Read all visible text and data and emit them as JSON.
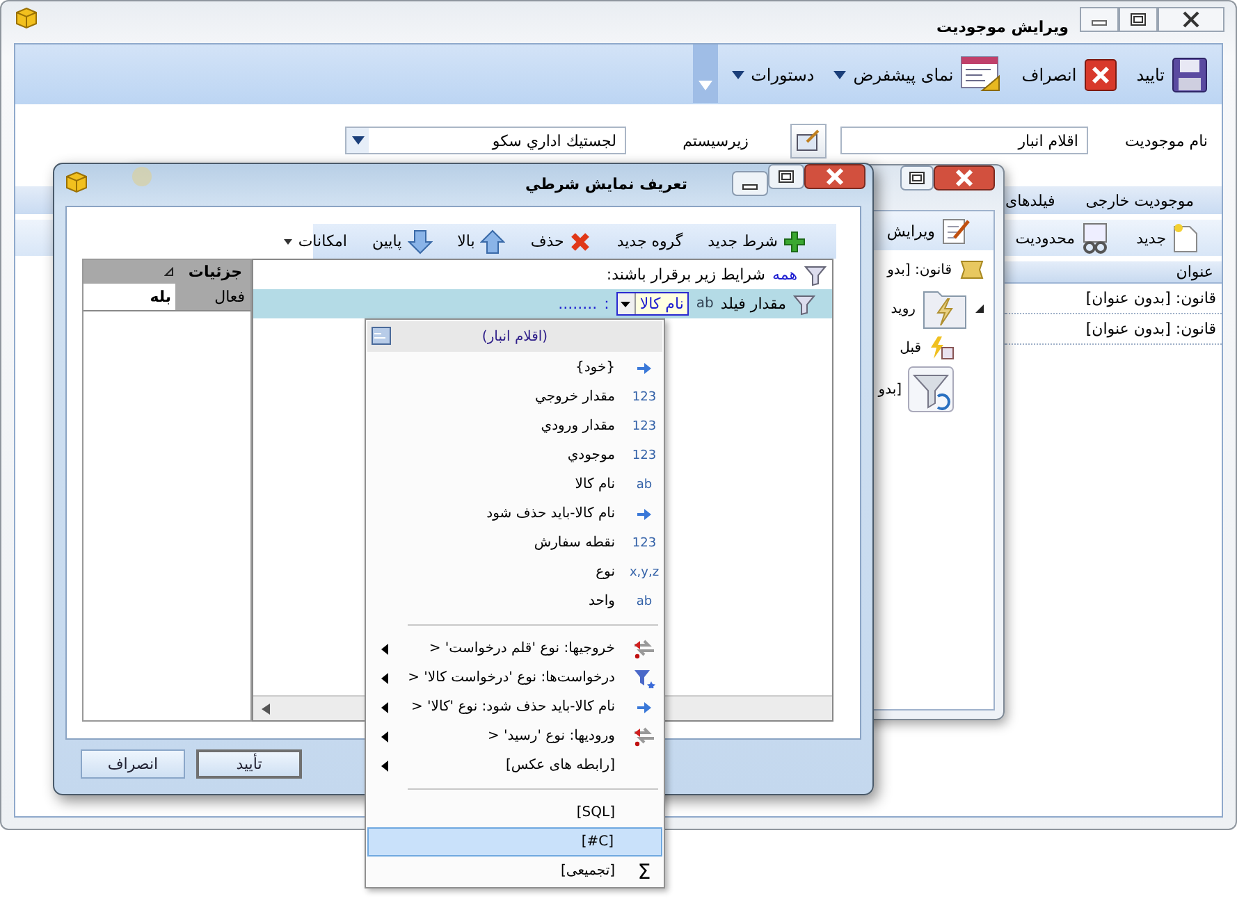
{
  "main_window": {
    "title": "ویرایش موجودیت"
  },
  "main_toolbar": [
    {
      "kind": "save",
      "label": "تایید",
      "dropdown": false
    },
    {
      "kind": "cancel",
      "label": "انصراف",
      "dropdown": false
    },
    {
      "kind": "layout",
      "label": "نمای پیشفرض",
      "dropdown": true
    },
    {
      "kind": "none",
      "label": "دستورات",
      "dropdown": true
    }
  ],
  "entity_name": {
    "label": "نام موجودیت",
    "value": "اقلام انبار"
  },
  "subsystem": {
    "label": "زیرسیستم",
    "value": "لجستيك اداري سكو"
  },
  "entity_tabs": [
    {
      "label": "موجودیت خارجی",
      "selected": false
    },
    {
      "label": "فیلدهای",
      "selected": false
    }
  ],
  "rules_toolbar": [
    {
      "kind": "new",
      "label": "جدید"
    },
    {
      "kind": "restriction",
      "label": "محدودیت"
    }
  ],
  "rules_table": {
    "columns": [
      "عنوان"
    ],
    "rows": [
      "قانون: [بدون عنوان]",
      "قانون: [بدون عنوان]"
    ]
  },
  "rule_window": {
    "toolbar": [
      {
        "kind": "edit",
        "label": "ویرایش"
      }
    ],
    "tree": [
      {
        "kind": "rule",
        "label": "قانون: [بدو"
      },
      {
        "kind": "event",
        "label": "روید",
        "expanded": true
      },
      {
        "kind": "before",
        "label": "قبل"
      },
      {
        "kind": "filter",
        "label": "[بدو"
      }
    ]
  },
  "dialog": {
    "title": "تعریف نمایش شرطي",
    "toolbar": [
      {
        "kind": "add",
        "label": "شرط جدید"
      },
      {
        "kind": "none",
        "label": "گروه جدید"
      },
      {
        "kind": "delete",
        "label": "حذف"
      },
      {
        "kind": "up",
        "label": "بالا"
      },
      {
        "kind": "down",
        "label": "پایین"
      },
      {
        "kind": "menu",
        "label": "امکانات"
      }
    ],
    "details": {
      "title": "جزئیات",
      "rows": [
        {
          "name": "فعال",
          "value": "بله"
        }
      ]
    },
    "condition": {
      "quantifier": "همه",
      "text": "شرایط زیر برقرار باشند:",
      "rows": [
        {
          "label": "مقدار فیلد",
          "type_label": "ab",
          "field": "نام کالا",
          "operator": ":",
          "value": "........",
          "selected": true
        }
      ]
    },
    "buttons": [
      {
        "label": "تأیید",
        "default": true
      },
      {
        "label": "انصراف",
        "default": false
      }
    ]
  },
  "field_menu": {
    "header": "(اقلام انبار)",
    "sections": [
      [
        {
          "kind": "arrow",
          "label": "{خود}",
          "submenu": false,
          "selected": false
        },
        {
          "kind": "typed",
          "type_label": "123",
          "label": "مقدار خروجي",
          "submenu": false,
          "selected": false
        },
        {
          "kind": "typed",
          "type_label": "123",
          "label": "مقدار ورودي",
          "submenu": false,
          "selected": false
        },
        {
          "kind": "typed",
          "type_label": "123",
          "label": "موجودي",
          "submenu": false,
          "selected": false
        },
        {
          "kind": "typed",
          "type_label": "ab",
          "label": "نام کالا",
          "submenu": false,
          "selected": false
        },
        {
          "kind": "arrow",
          "label": "نام کالا-باید حذف شود",
          "submenu": false,
          "selected": false
        },
        {
          "kind": "typed",
          "type_label": "123",
          "label": "نقطه سفارش",
          "submenu": false,
          "selected": false
        },
        {
          "kind": "typed",
          "type_label": "x,y,z",
          "label": "نوع",
          "submenu": false,
          "selected": false
        },
        {
          "kind": "typed",
          "type_label": "ab",
          "label": "واحد",
          "submenu": false,
          "selected": false
        }
      ],
      [
        {
          "kind": "relation",
          "label": "خروجیها: نوع 'قلم درخواست' <",
          "submenu": true,
          "selected": false
        },
        {
          "kind": "filter",
          "label": "درخواست‌ها: نوع 'درخواست کالا' <",
          "submenu": true,
          "selected": false
        },
        {
          "kind": "arrow",
          "label": "نام کالا-باید حذف شود: نوع 'کالا' <",
          "submenu": true,
          "selected": false
        },
        {
          "kind": "relation",
          "label": "ورودیها: نوع 'رسید' <",
          "submenu": true,
          "selected": false
        },
        {
          "kind": "plain",
          "label": "[رابطه های عکس]",
          "submenu": true,
          "selected": false
        }
      ],
      [
        {
          "kind": "plain",
          "label": "[SQL]",
          "submenu": false,
          "selected": false
        },
        {
          "kind": "plain",
          "label": "[C#]",
          "submenu": false,
          "selected": true
        },
        {
          "kind": "symbol",
          "type_label": "Σ",
          "label": "[تجمیعی]",
          "submenu": false,
          "selected": false
        }
      ]
    ]
  }
}
